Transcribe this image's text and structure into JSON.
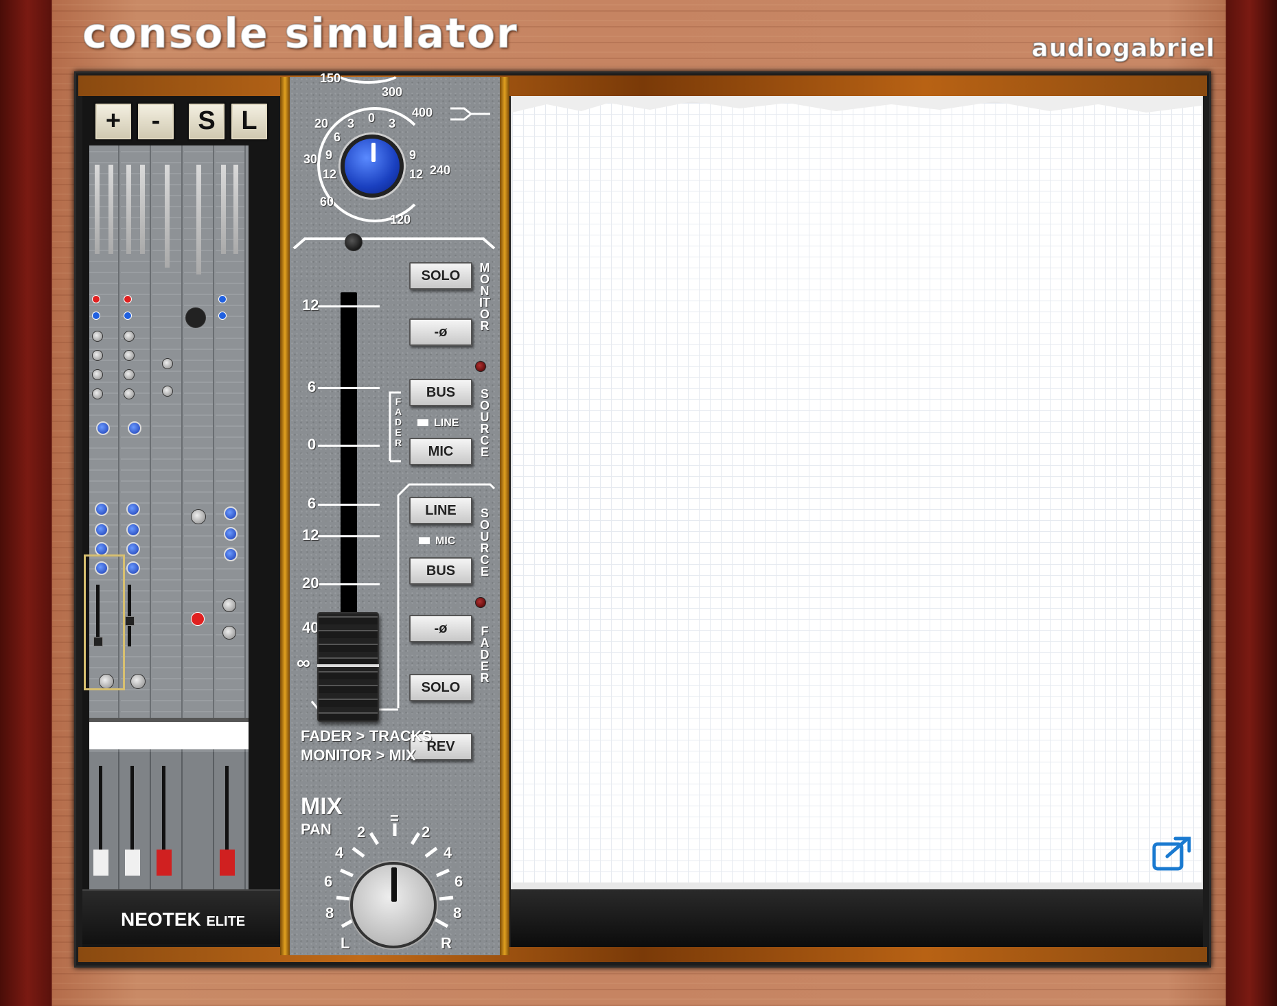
{
  "app": {
    "title": "console simulator",
    "brand": "audiogabriel"
  },
  "toolbar": {
    "add": "+",
    "remove": "-",
    "save": "S",
    "load": "L"
  },
  "console": {
    "name": "NEOTEK",
    "model": "ELITE"
  },
  "strip": {
    "trim_scale": {
      "outer": [
        "150",
        "300",
        "400",
        "240",
        "120",
        "60",
        "30",
        "20"
      ],
      "inner": [
        "0",
        "3",
        "6",
        "9",
        "12",
        "3",
        "9",
        "12"
      ]
    },
    "fader_scale": [
      "12",
      "6",
      "0",
      "6",
      "12",
      "20",
      "40",
      "∞"
    ],
    "monitor": {
      "solo": "SOLO",
      "phase": "-ø",
      "bus": "BUS",
      "line_indicator": "LINE",
      "mic": "MIC",
      "monitor_vertical": "MONITOR",
      "source_vertical": "SOURCE",
      "fader_vertical": "FADER"
    },
    "tracks": {
      "line": "LINE",
      "mic_indicator": "MIC",
      "bus": "BUS",
      "phase": "-ø",
      "solo": "SOLO",
      "rev": "REV",
      "source_vertical": "SOURCE",
      "fader_vertical": "FADER"
    },
    "routing_line1": "FADER > TRACKS",
    "routing_line2": "MONITOR > MIX",
    "mix_label": "MIX",
    "pan_label": "PAN",
    "pan_scale": [
      "2",
      "4",
      "6",
      "8",
      "L",
      "=",
      "2",
      "4",
      "6",
      "8",
      "R"
    ]
  },
  "colors": {
    "accent_blue": "#1a40c0",
    "wood": "#c68462",
    "brass": "#e0a020"
  },
  "icons": {
    "popout": "external-link-icon"
  }
}
